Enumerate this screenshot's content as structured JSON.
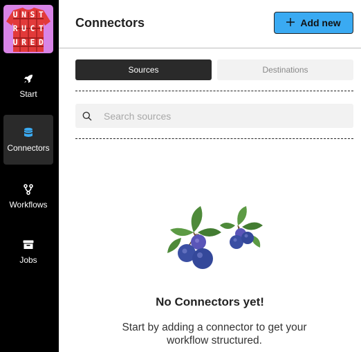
{
  "sidebar": {
    "logo_text": [
      "UNST",
      "RUCT",
      "URED"
    ],
    "items": [
      {
        "label": "Start",
        "icon": "rocket-icon",
        "active": false
      },
      {
        "label": "Connectors",
        "icon": "database-icon",
        "active": true
      },
      {
        "label": "Workflows",
        "icon": "workflow-icon",
        "active": false
      },
      {
        "label": "Jobs",
        "icon": "archive-icon",
        "active": false
      }
    ]
  },
  "header": {
    "title": "Connectors",
    "add_button_label": "Add new"
  },
  "tabs": [
    {
      "label": "Sources",
      "active": true
    },
    {
      "label": "Destinations",
      "active": false
    }
  ],
  "search": {
    "placeholder": "Search sources",
    "value": ""
  },
  "empty_state": {
    "illustration": "blueberries",
    "title": "No Connectors yet!",
    "description": "Start by adding a connector to get your workflow structured."
  },
  "colors": {
    "sidebar_bg": "#000000",
    "accent": "#3aaaf2",
    "logo_bg": "#d884e6",
    "logo_red": "#e23a3a",
    "active_tab": "#2a2a2a",
    "berry": "#3b4fa3"
  }
}
